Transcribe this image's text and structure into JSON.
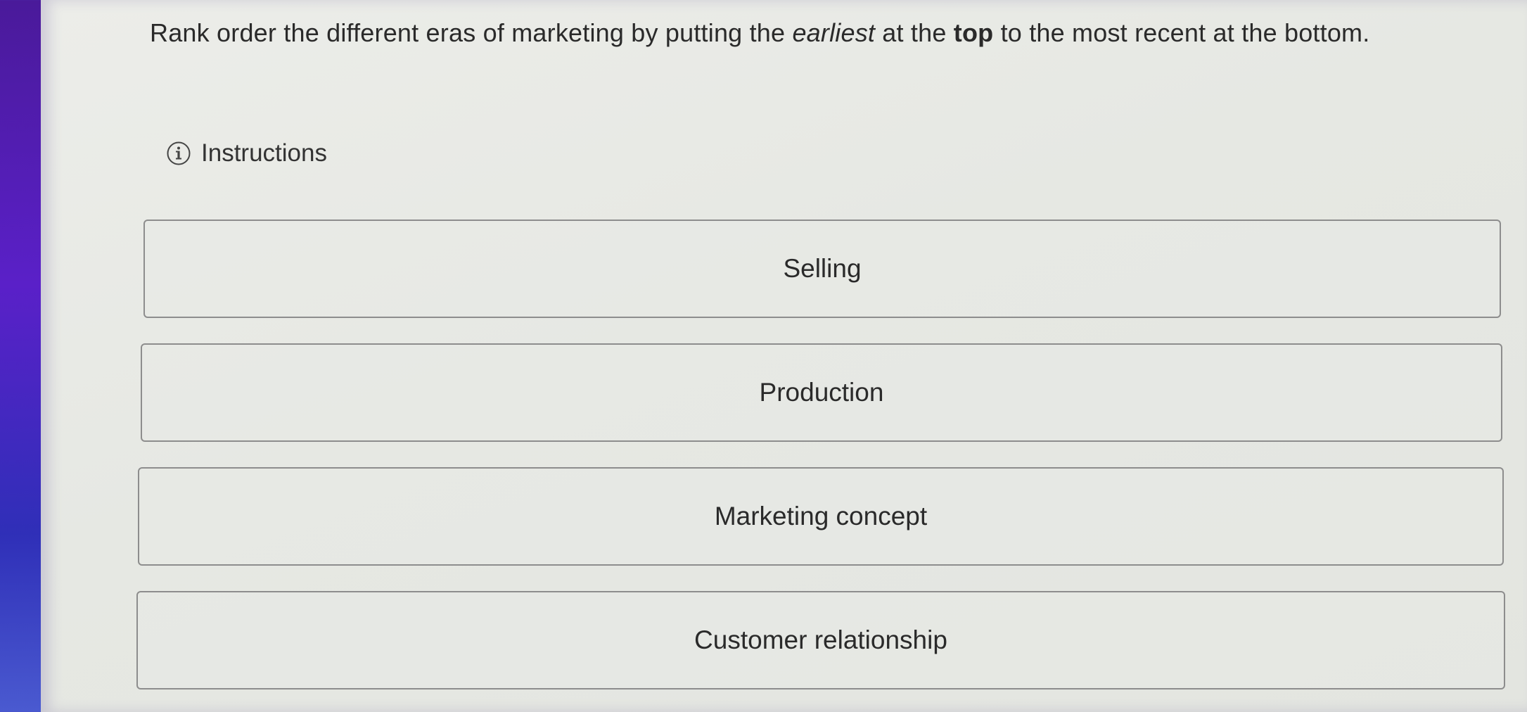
{
  "question": {
    "before_earliest": "Rank order the different eras of marketing by putting the ",
    "earliest": "earliest",
    "middle": " at the ",
    "top": "top",
    "after_top": " to the most recent at the bottom."
  },
  "instructions": {
    "label": "Instructions",
    "icon": "info-icon"
  },
  "rank_items": [
    {
      "label": "Selling"
    },
    {
      "label": "Production"
    },
    {
      "label": "Marketing concept"
    },
    {
      "label": "Customer relationship"
    }
  ],
  "colors": {
    "background": "#e6e8e3",
    "border": "#8d8d8d",
    "text": "#2a2a2a",
    "edge_purple": "#5a20c8"
  }
}
